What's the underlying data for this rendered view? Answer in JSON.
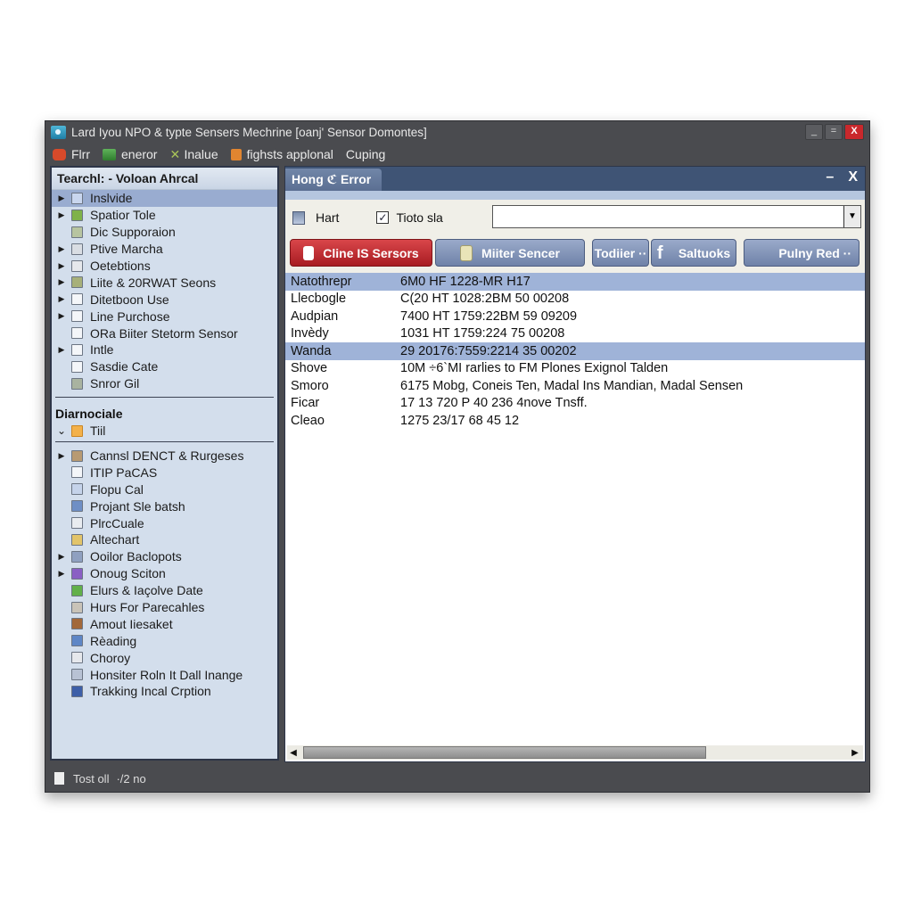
{
  "window": {
    "title": "Lard Iyou NPO & typte Sensers Mechrine [oanj' Sensor Domontes]",
    "controls": {
      "minimize": "_",
      "maximize": "=",
      "close": "X"
    }
  },
  "menubar": {
    "items": [
      {
        "label": "Flrr",
        "icon": "red-badge-icon",
        "color": "#d84a2a"
      },
      {
        "label": "eneror",
        "icon": "green-grid-icon",
        "color": "#4ca04a"
      },
      {
        "label": "Inalue",
        "icon": "tool-icon",
        "color": "#8aa84a"
      },
      {
        "label": "fighsts applonal",
        "icon": "orange-doc-icon",
        "color": "#e08530"
      },
      {
        "label": "Cuping",
        "icon": "",
        "color": ""
      }
    ]
  },
  "sidebar": {
    "header": "Tearchl: - Voloan Ahrcal",
    "items": [
      {
        "label": "Inslvide",
        "arrow": true,
        "selected": true
      },
      {
        "label": "Spatior Tole",
        "arrow": true
      },
      {
        "label": "Dic Supporaion",
        "arrow": false
      },
      {
        "label": "Ptive Marcha",
        "arrow": true
      },
      {
        "label": "Oetebtions",
        "arrow": true
      },
      {
        "label": "Liite & 20RWAT Seons",
        "arrow": true
      },
      {
        "label": "Ditetboon Use",
        "arrow": true
      },
      {
        "label": "Line Purchose",
        "arrow": true
      },
      {
        "label": "ORa Biiter Stetorm Sensor",
        "arrow": false
      },
      {
        "label": "Intle",
        "arrow": true
      },
      {
        "label": "Sasdie Cate",
        "arrow": false
      },
      {
        "label": "Snror Gil",
        "arrow": false
      }
    ],
    "section2_title": "Diarnociale",
    "section2_folder": "Tiil",
    "items2": [
      {
        "label": "Cannsl DENCT & Rurgeses",
        "arrow": true
      },
      {
        "label": "ITIP PaCAS",
        "arrow": false
      },
      {
        "label": "Flopu Cal",
        "arrow": false
      },
      {
        "label": "Projant Sle batsh",
        "arrow": false
      },
      {
        "label": "PlrcCuale",
        "arrow": false
      },
      {
        "label": "Altechart",
        "arrow": false
      },
      {
        "label": "Ooilor Baclopots",
        "arrow": true
      },
      {
        "label": "Onoug Sciton",
        "arrow": true
      },
      {
        "label": "Elurs & Iaçolve Date",
        "arrow": false
      },
      {
        "label": "Hurs For Parecahles",
        "arrow": false
      },
      {
        "label": "Amout Iiesaket",
        "arrow": false
      },
      {
        "label": "Rèading",
        "arrow": false
      },
      {
        "label": "Choroy",
        "arrow": false
      },
      {
        "label": "Honsiter Roln It Dall Inange",
        "arrow": false
      },
      {
        "label": "Trakking Incal Crption",
        "arrow": false
      }
    ]
  },
  "main": {
    "tab": "Hong ℭ Error",
    "header_min": "–",
    "header_close": "X",
    "toolbar": {
      "hart_label": "Hart",
      "checkbox_label": "Tioto sla",
      "checkbox_checked": true,
      "combo_value": "",
      "combo_arrow": "▼"
    },
    "buttons": [
      {
        "label": "Cline IS Sersors",
        "style": "red"
      },
      {
        "label": "Miiter Sencer",
        "style": "blue"
      },
      {
        "label": "Todiier ··",
        "style": "blue"
      },
      {
        "label": "Saltuoks",
        "style": "blue"
      },
      {
        "label": "Pulny Red ··",
        "style": "blue"
      }
    ],
    "rows": [
      {
        "name": "Natothrepr",
        "value": "6M0 HF 1228-MR H17",
        "highlight": true
      },
      {
        "name": "Llecbogle",
        "value": "C(20 HT 1028:2BM 50 00208",
        "highlight": false
      },
      {
        "name": "Audpian",
        "value": "7400 HT 1759:22BM 59 09209",
        "highlight": false
      },
      {
        "name": "Invèdy",
        "value": "1031 HT 1759:224 75 00208",
        "highlight": false
      },
      {
        "name": "Wanda",
        "value": "29 20176:7559:2214 35 00202",
        "highlight": true
      },
      {
        "name": "Shove",
        "value": "10M ÷6`MI rarlies to FM Plones Exignol Talden",
        "highlight": false
      },
      {
        "name": "Smoro",
        "value": "6175 Mobg, Coneis Ten, Madal Ins Mandian, Madal Sensen",
        "highlight": false
      },
      {
        "name": "Ficar",
        "value": "17 13 720 P 40 236 4nove Tnsff.",
        "highlight": false
      },
      {
        "name": "Cleao",
        "value": "1275 23/17 68 45 12",
        "highlight": false
      }
    ],
    "scroll_left": "◀",
    "scroll_right": "▶"
  },
  "statusbar": {
    "text1": "Tost oll",
    "text2": "·/2 no"
  }
}
